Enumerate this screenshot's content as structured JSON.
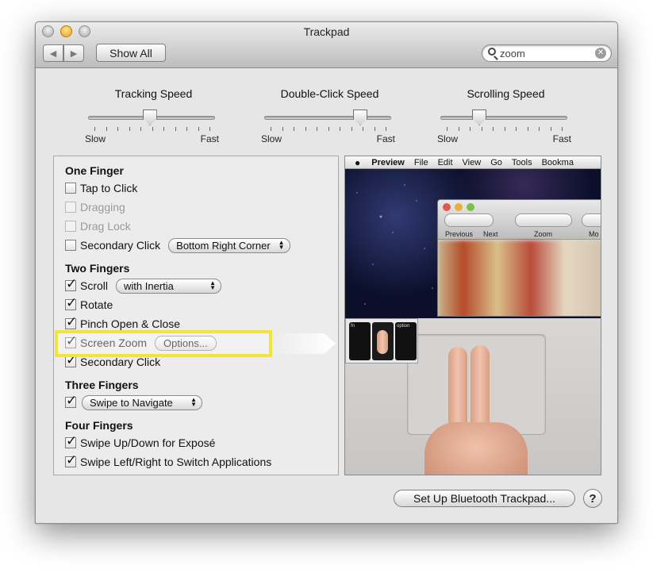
{
  "window": {
    "title": "Trackpad",
    "show_all_label": "Show All",
    "back_icon": "◀",
    "forward_icon": "▶",
    "search": {
      "value": "zoom",
      "clear_icon": "✕"
    }
  },
  "sliders": [
    {
      "title": "Tracking Speed",
      "min_label": "Slow",
      "max_label": "Fast",
      "position": 0.45
    },
    {
      "title": "Double-Click Speed",
      "min_label": "Slow",
      "max_label": "Fast",
      "position": 0.75
    },
    {
      "title": "Scrolling Speed",
      "min_label": "Slow",
      "max_label": "Fast",
      "position": 0.25
    }
  ],
  "gestures": {
    "one_finger": {
      "heading": "One Finger",
      "tap_to_click": {
        "label": "Tap to Click",
        "checked": false
      },
      "dragging": {
        "label": "Dragging",
        "checked": false,
        "disabled": true
      },
      "drag_lock": {
        "label": "Drag Lock",
        "checked": false,
        "disabled": true
      },
      "secondary_click": {
        "label": "Secondary Click",
        "checked": false,
        "popup": "Bottom Right Corner"
      }
    },
    "two_fingers": {
      "heading": "Two Fingers",
      "scroll": {
        "label": "Scroll",
        "checked": true,
        "popup": "with Inertia"
      },
      "rotate": {
        "label": "Rotate",
        "checked": true
      },
      "pinch": {
        "label": "Pinch Open & Close",
        "checked": true
      },
      "screen_zoom": {
        "label": "Screen Zoom",
        "checked": true,
        "options_label": "Options..."
      },
      "secondary_click": {
        "label": "Secondary Click",
        "checked": true
      }
    },
    "three_fingers": {
      "heading": "Three Fingers",
      "swipe": {
        "checked": true,
        "popup": "Swipe to Navigate"
      }
    },
    "four_fingers": {
      "heading": "Four Fingers",
      "swipe_updown": {
        "label": "Swipe Up/Down for Exposé",
        "checked": true
      },
      "swipe_leftright": {
        "label": "Swipe Left/Right to Switch Applications",
        "checked": true
      }
    }
  },
  "preview": {
    "menu": [
      "Preview",
      "File",
      "Edit",
      "View",
      "Go",
      "Tools",
      "Bookma"
    ],
    "toolbar_labels": [
      "Previous",
      "Next",
      "Zoom",
      "Mo"
    ],
    "keys": [
      "fn",
      "",
      "option"
    ]
  },
  "footer": {
    "bluetooth_button": "Set Up Bluetooth Trackpad...",
    "help_label": "?"
  },
  "colors": {
    "highlight": "#f1e43c",
    "window_bg": "#e6e6e6"
  }
}
